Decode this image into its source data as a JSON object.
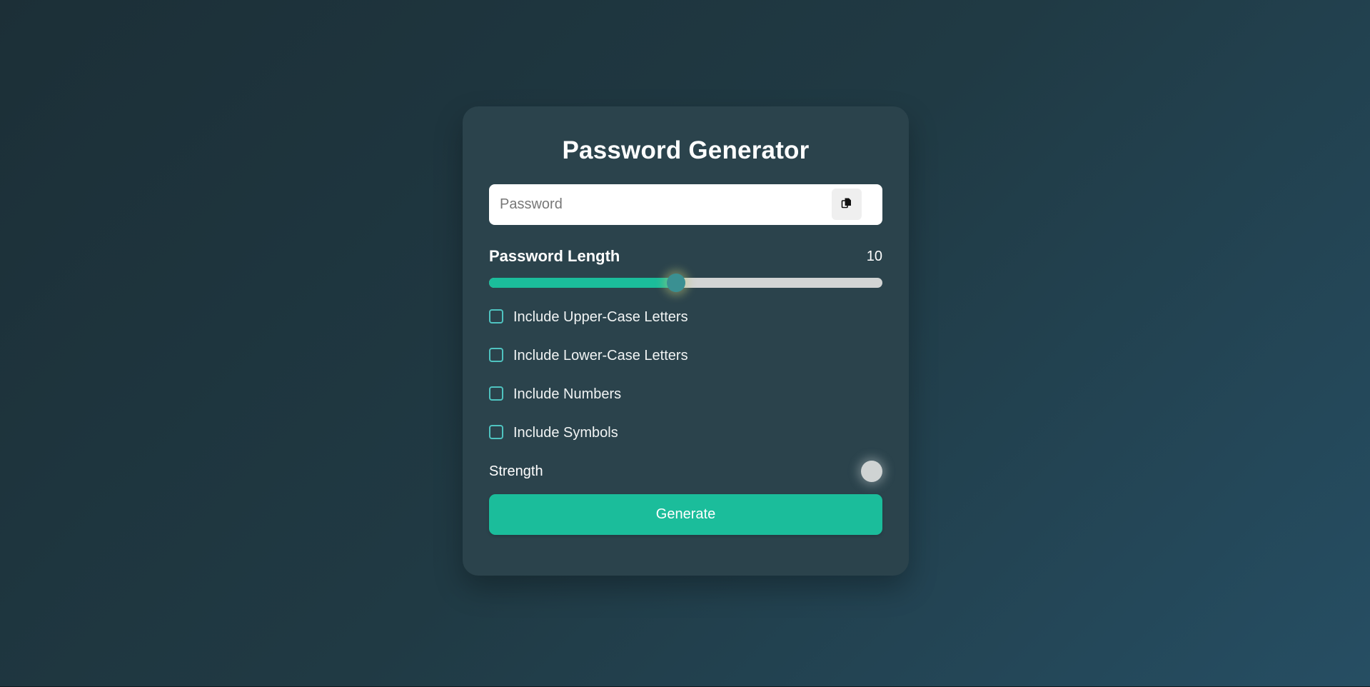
{
  "title": "Password Generator",
  "password": {
    "value": "",
    "placeholder": "Password",
    "copy_icon": "copy-icon"
  },
  "length": {
    "label": "Password Length",
    "value": "10",
    "slider_fraction": 0.475
  },
  "options": [
    {
      "label": "Include Upper-Case Letters",
      "checked": false
    },
    {
      "label": "Include Lower-Case Letters",
      "checked": false
    },
    {
      "label": "Include Numbers",
      "checked": false
    },
    {
      "label": "Include Symbols",
      "checked": false
    }
  ],
  "strength": {
    "label": "Strength",
    "indicator_color": "#cfd3d3"
  },
  "generate_label": "Generate",
  "colors": {
    "accent": "#1bbd9b",
    "checkbox_border": "#4fc3c0",
    "card_bg": "#2b434c",
    "slider_thumb": "#3a9092"
  }
}
